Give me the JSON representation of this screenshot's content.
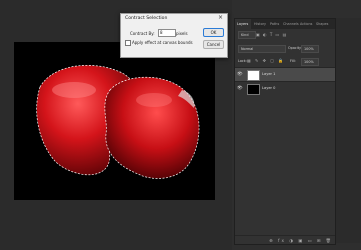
{
  "dialog": {
    "title": "Contract Selection",
    "close_glyph": "×",
    "contract_label": "Contract By:",
    "contract_value": "8",
    "contract_unit": "pixels",
    "apply_label": "Apply effect at canvas bounds",
    "ok_label": "OK",
    "cancel_label": "Cancel"
  },
  "panel": {
    "tabs": [
      "Layers",
      "History",
      "Paths",
      "Channels",
      "Actions",
      "Shapes"
    ],
    "kind_filter": "Kind",
    "filter_icons": "▣ ◐ T ▭ ▤",
    "blend_mode": "Normal",
    "opacity_label": "Opacity:",
    "opacity_value": "100%",
    "lock_label": "Lock:",
    "lock_icons": "▦ ✎ ✥ ▢ 🔒",
    "fill_label": "Fill:",
    "fill_value": "100%",
    "layers": [
      {
        "name": "Layer 1",
        "thumb": "gloves",
        "selected": true
      },
      {
        "name": "Layer 0",
        "thumb": "black",
        "selected": false
      }
    ],
    "bottom_icons": "⊕ fx ◑ ▣ ▭ ⊞ 🗑",
    "eye_icon": "👁"
  },
  "colors": {
    "glove_red": "#d4141a",
    "panel_bg": "#323232",
    "canvas_bg": "#000000",
    "selection_outline": "#ffffff"
  }
}
